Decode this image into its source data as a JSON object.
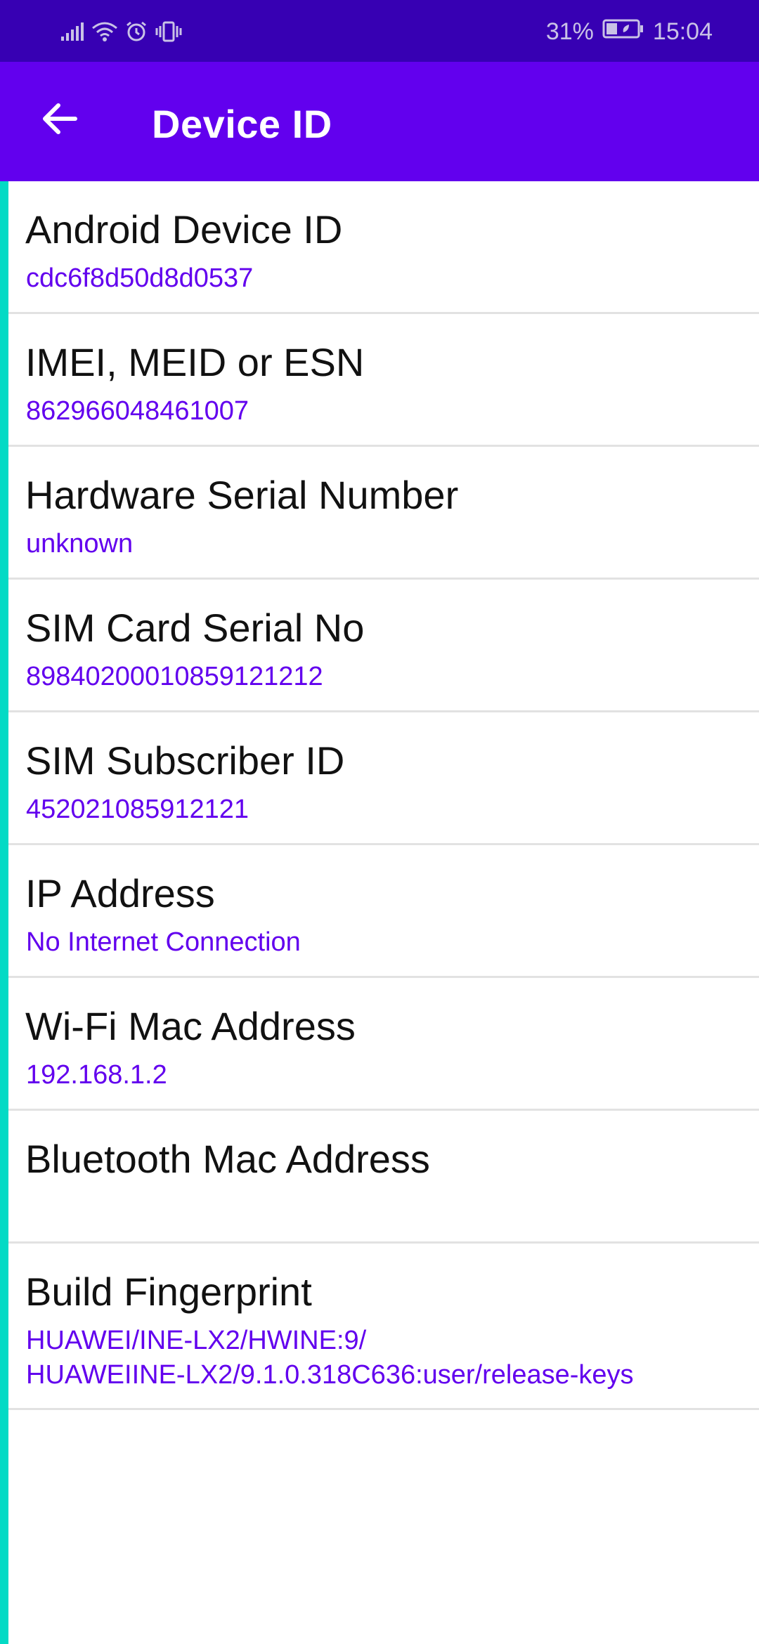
{
  "status_bar": {
    "battery_percent": "31%",
    "time": "15:04",
    "icons": [
      "signal-icon",
      "wifi-icon",
      "alarm-icon",
      "vibrate-icon",
      "battery-icon"
    ]
  },
  "app_bar": {
    "title": "Device ID",
    "back_icon": "arrow-left-icon"
  },
  "colors": {
    "status_bar": "#3700b3",
    "app_bar": "#6200ee",
    "accent": "#03dac5",
    "value_text": "#6200ee"
  },
  "items": [
    {
      "label": "Android Device ID",
      "value": "cdc6f8d50d8d0537"
    },
    {
      "label": "IMEI, MEID or ESN",
      "value": "862966048461007"
    },
    {
      "label": "Hardware Serial Number",
      "value": "unknown"
    },
    {
      "label": "SIM Card Serial No",
      "value": "89840200010859121212"
    },
    {
      "label": "SIM Subscriber ID",
      "value": "452021085912121"
    },
    {
      "label": "IP Address",
      "value": "No Internet Connection"
    },
    {
      "label": "Wi-Fi Mac Address",
      "value": "192.168.1.2"
    },
    {
      "label": "Bluetooth Mac Address",
      "value": ""
    },
    {
      "label": "Build Fingerprint",
      "value_lines": [
        "HUAWEI/INE-LX2/HWINE:9/",
        "HUAWEIINE-LX2/9.1.0.318C636:user/release-keys"
      ]
    }
  ]
}
